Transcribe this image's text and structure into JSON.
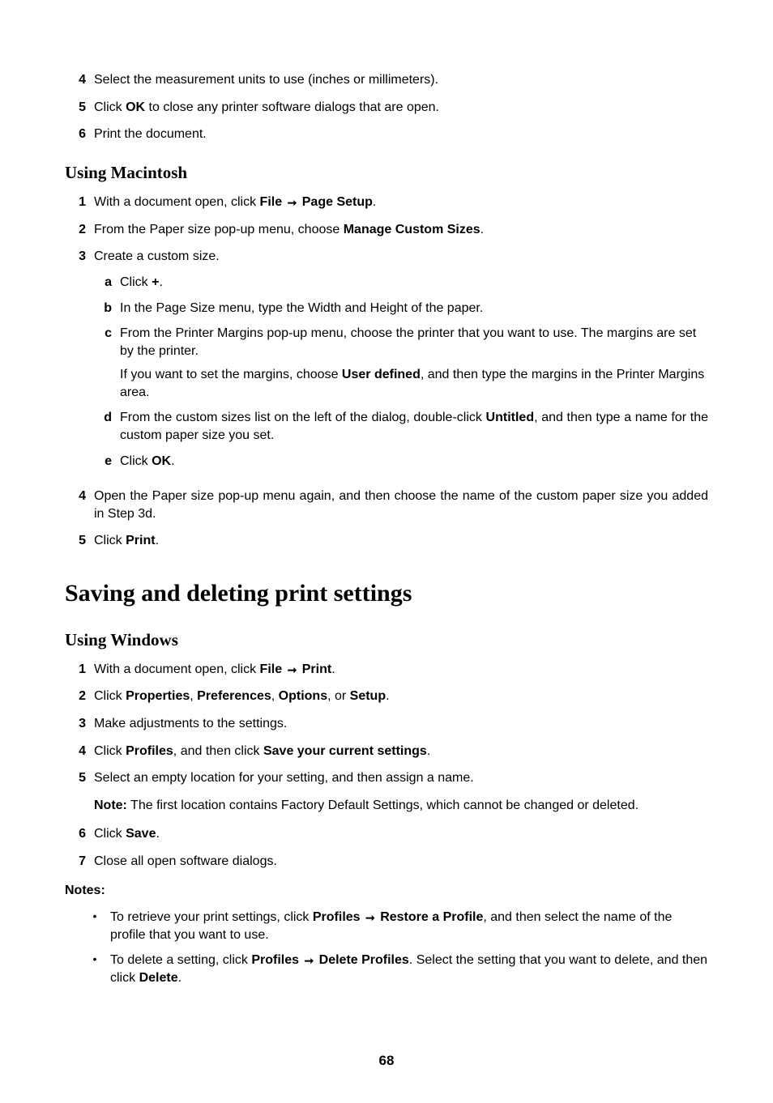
{
  "topList": [
    {
      "marker": "4",
      "text": "Select the measurement units to use (inches or millimeters)."
    },
    {
      "marker": "5",
      "pre": "Click ",
      "bold": "OK",
      "post": " to close any printer software dialogs that are open."
    },
    {
      "marker": "6",
      "text": "Print the document."
    }
  ],
  "headingMac": "Using Macintosh",
  "macList": {
    "item1": {
      "marker": "1",
      "pre": "With a document open, click ",
      "b1": "File",
      "b2": "Page Setup",
      "post": "."
    },
    "item2": {
      "marker": "2",
      "pre": "From the Paper size pop-up menu, choose ",
      "b1": "Manage Custom Sizes",
      "post": "."
    },
    "item3": {
      "marker": "3",
      "text": "Create a custom size."
    },
    "sub_a": {
      "marker": "a",
      "pre": "Click ",
      "b1": "+",
      "post": "."
    },
    "sub_b": {
      "marker": "b",
      "text": "In the Page Size menu, type the Width and Height of the paper."
    },
    "sub_c": {
      "marker": "c",
      "text": "From the Printer Margins pop-up menu, choose the printer that you want to use. The margins are set by the printer.",
      "extra_pre": "If you want to set the margins, choose ",
      "extra_b": "User defined",
      "extra_post": ", and then type the margins in the Printer Margins area."
    },
    "sub_d": {
      "marker": "d",
      "pre": "From the custom sizes list on the left of the dialog, double-click ",
      "b1": "Untitled",
      "post": ", and then type a name for the custom paper size you set."
    },
    "sub_e": {
      "marker": "e",
      "pre": "Click ",
      "b1": "OK",
      "post": "."
    },
    "item4": {
      "marker": "4",
      "text": "Open the Paper size pop-up menu again, and then choose the name of the custom paper size you added in Step 3d."
    },
    "item5": {
      "marker": "5",
      "pre": "Click ",
      "b1": "Print",
      "post": "."
    }
  },
  "headingSave": "Saving and deleting print settings",
  "headingWin": "Using Windows",
  "winList": {
    "item1": {
      "marker": "1",
      "pre": "With a document open, click ",
      "b1": "File",
      "b2": "Print",
      "post": "."
    },
    "item2": {
      "marker": "2",
      "pre": "Click ",
      "b1": "Properties",
      "sep1": ", ",
      "b2": "Preferences",
      "sep2": ", ",
      "b3": "Options",
      "sep3": ", or ",
      "b4": "Setup",
      "post": "."
    },
    "item3": {
      "marker": "3",
      "text": "Make adjustments to the settings."
    },
    "item4": {
      "marker": "4",
      "pre": "Click ",
      "b1": "Profiles",
      "mid": ", and then click ",
      "b2": "Save your current settings",
      "post": "."
    },
    "item5": {
      "marker": "5",
      "text": "Select an empty location for your setting, and then assign a name."
    },
    "note5": {
      "label": "Note:",
      "text": " The first location contains Factory Default Settings, which cannot be changed or deleted."
    },
    "item6": {
      "marker": "6",
      "pre": "Click ",
      "b1": "Save",
      "post": "."
    },
    "item7": {
      "marker": "7",
      "text": "Close all open software dialogs."
    }
  },
  "notesHeader": "Notes:",
  "notesList": {
    "n1": {
      "pre": "To retrieve your print settings, click ",
      "b1": "Profiles",
      "b2": "Restore a Profile",
      "post": ", and then select the name of the profile that you want to use."
    },
    "n2": {
      "pre": "To delete a setting, click ",
      "b1": "Profiles",
      "b2": "Delete Profiles",
      "mid": ". Select the setting that you want to delete, and then click ",
      "b3": "Delete",
      "post": "."
    }
  },
  "pageNumber": "68",
  "bulletGlyph": "•",
  "arrowGlyph": "➞"
}
